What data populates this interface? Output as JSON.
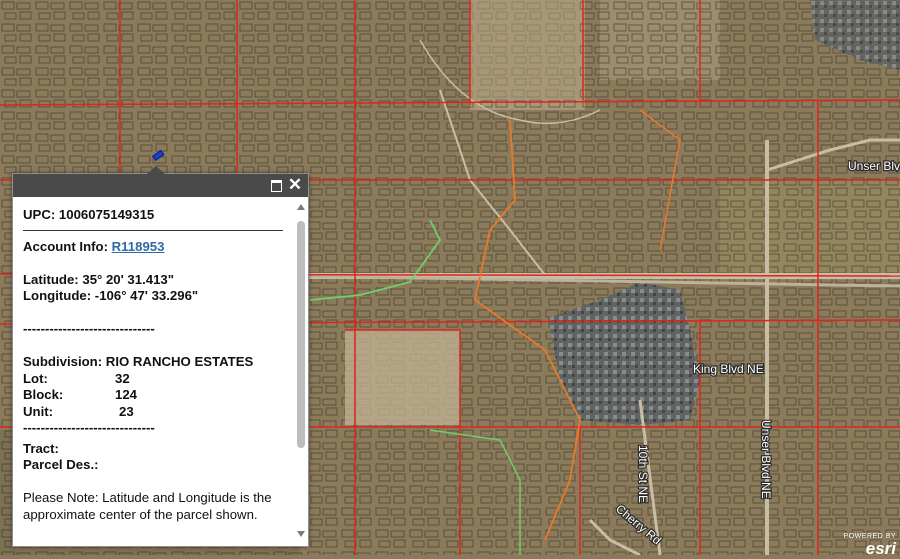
{
  "map": {
    "road_labels": [
      "Unser Blvd",
      "King Blvd NE",
      "10th St NE",
      "Cherry Rd",
      "Unser Blvd NE"
    ],
    "parcel_line_color": "#e0251c",
    "trail_color": "#e87a2a",
    "greenway_color": "#6fd06a",
    "marker_color": "#1a3fd6"
  },
  "popup": {
    "upc_label": "UPC:",
    "upc_value": "1006075149315",
    "account_label": "Account Info:",
    "account_link": "R118953",
    "latitude_label": "Latitude:",
    "latitude_value": "35° 20' 31.413\"",
    "longitude_label": "Longitude:",
    "longitude_value": "-106° 47' 33.296\"",
    "separator_1": "------------------------------",
    "subdivision_label": "Subdivision:",
    "subdivision_value": "RIO RANCHO ESTATES",
    "lot_label": "Lot:",
    "lot_value": "32",
    "block_label": "Block:",
    "block_value": "124",
    "unit_label": "Unit:",
    "unit_value": "23",
    "separator_2": "------------------------------",
    "tract_label": "Tract:",
    "parcel_des_label": "Parcel Des.:",
    "note": "Please Note: Latitude and Longitude is the approximate center of the parcel shown."
  },
  "attribution": {
    "powered_by": "POWERED BY",
    "brand": "esri"
  }
}
